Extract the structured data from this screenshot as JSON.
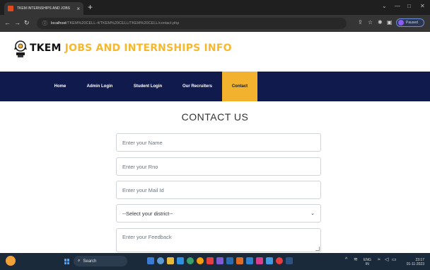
{
  "browser": {
    "tab_title": "TKEM INTERNSHIPS AND JOBS",
    "tab_close": "×",
    "new_tab": "+",
    "window_controls": [
      "⌄",
      "—",
      "□",
      "✕"
    ],
    "url_host": "localhost",
    "url_path": "/TKEM%20CELL-4/TKEM%20CELL/TKEM%20CELL/contact.php",
    "profile_status": "Paused"
  },
  "site": {
    "brand_black": "TKEM",
    "brand_yellow": " JOBS AND INTERNSHIPS INFO",
    "accent_color": "#f3b22d",
    "nav_color": "#101a4d"
  },
  "nav": {
    "items": [
      "Home",
      "Admin Login",
      "Student Login",
      "Our Recruiters",
      "Contact"
    ],
    "active_index": 4
  },
  "form": {
    "heading": "CONTACT US",
    "name_placeholder": "Enter your Name",
    "rno_placeholder": "Enter your Rno",
    "mail_placeholder": "Enter your Mail Id",
    "district_selected": "--Select your district--",
    "feedback_placeholder": "Enter your Feedback"
  },
  "taskbar": {
    "search_label": "Search",
    "lang_top": "ENG",
    "lang_bottom": "IN",
    "time": "23:17",
    "date": "01-11-2023"
  }
}
